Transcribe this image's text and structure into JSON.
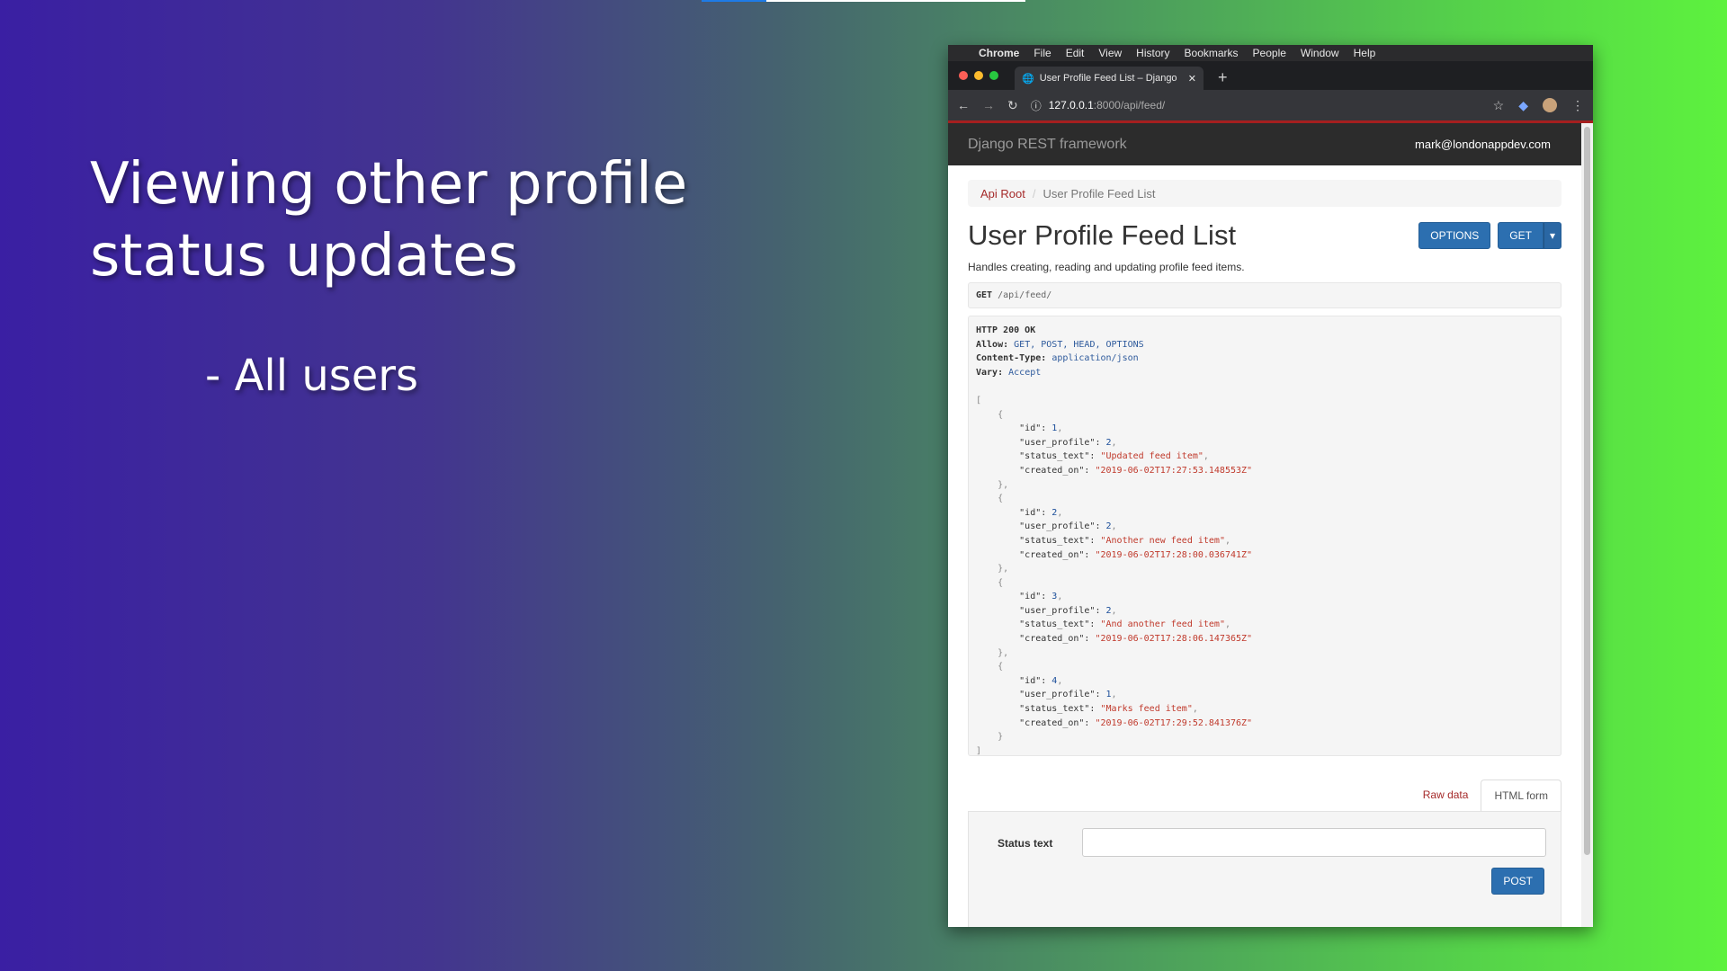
{
  "slide": {
    "title": "Viewing other profile status updates",
    "bullet": "- All users"
  },
  "browser": {
    "menu": {
      "apple_icon": "",
      "app": "Chrome",
      "items": [
        "File",
        "Edit",
        "View",
        "History",
        "Bookmarks",
        "People",
        "Window",
        "Help"
      ]
    },
    "tab_title": "User Profile Feed List – Django",
    "url_host": "127.0.0.1",
    "url_path": ":8000/api/feed/"
  },
  "drf": {
    "brand": "Django REST framework",
    "user": "mark@londonappdev.com",
    "breadcrumb": {
      "root": "Api Root",
      "current": "User Profile Feed List"
    },
    "page_title": "User Profile Feed List",
    "options_label": "OPTIONS",
    "get_label": "GET",
    "description": "Handles creating, reading and updating profile feed items.",
    "request_method": "GET",
    "request_path": "/api/feed/",
    "response_headers": {
      "status": "HTTP 200 OK",
      "allow_label": "Allow:",
      "allow_value": "GET, POST, HEAD, OPTIONS",
      "content_type_label": "Content-Type:",
      "content_type_value": "application/json",
      "vary_label": "Vary:",
      "vary_value": "Accept"
    },
    "items": [
      {
        "id": "1",
        "user_profile": "2",
        "status_text": "Updated feed item",
        "created_on": "2019-06-02T17:27:53.148553Z"
      },
      {
        "id": "2",
        "user_profile": "2",
        "status_text": "Another new feed item",
        "created_on": "2019-06-02T17:28:00.036741Z"
      },
      {
        "id": "3",
        "user_profile": "2",
        "status_text": "And another feed item",
        "created_on": "2019-06-02T17:28:06.147365Z"
      },
      {
        "id": "4",
        "user_profile": "1",
        "status_text": "Marks feed item",
        "created_on": "2019-06-02T17:29:52.841376Z"
      }
    ],
    "form_tabs": {
      "raw": "Raw data",
      "html": "HTML form"
    },
    "form": {
      "field_label": "Status text",
      "field_value": "",
      "submit": "POST"
    }
  }
}
